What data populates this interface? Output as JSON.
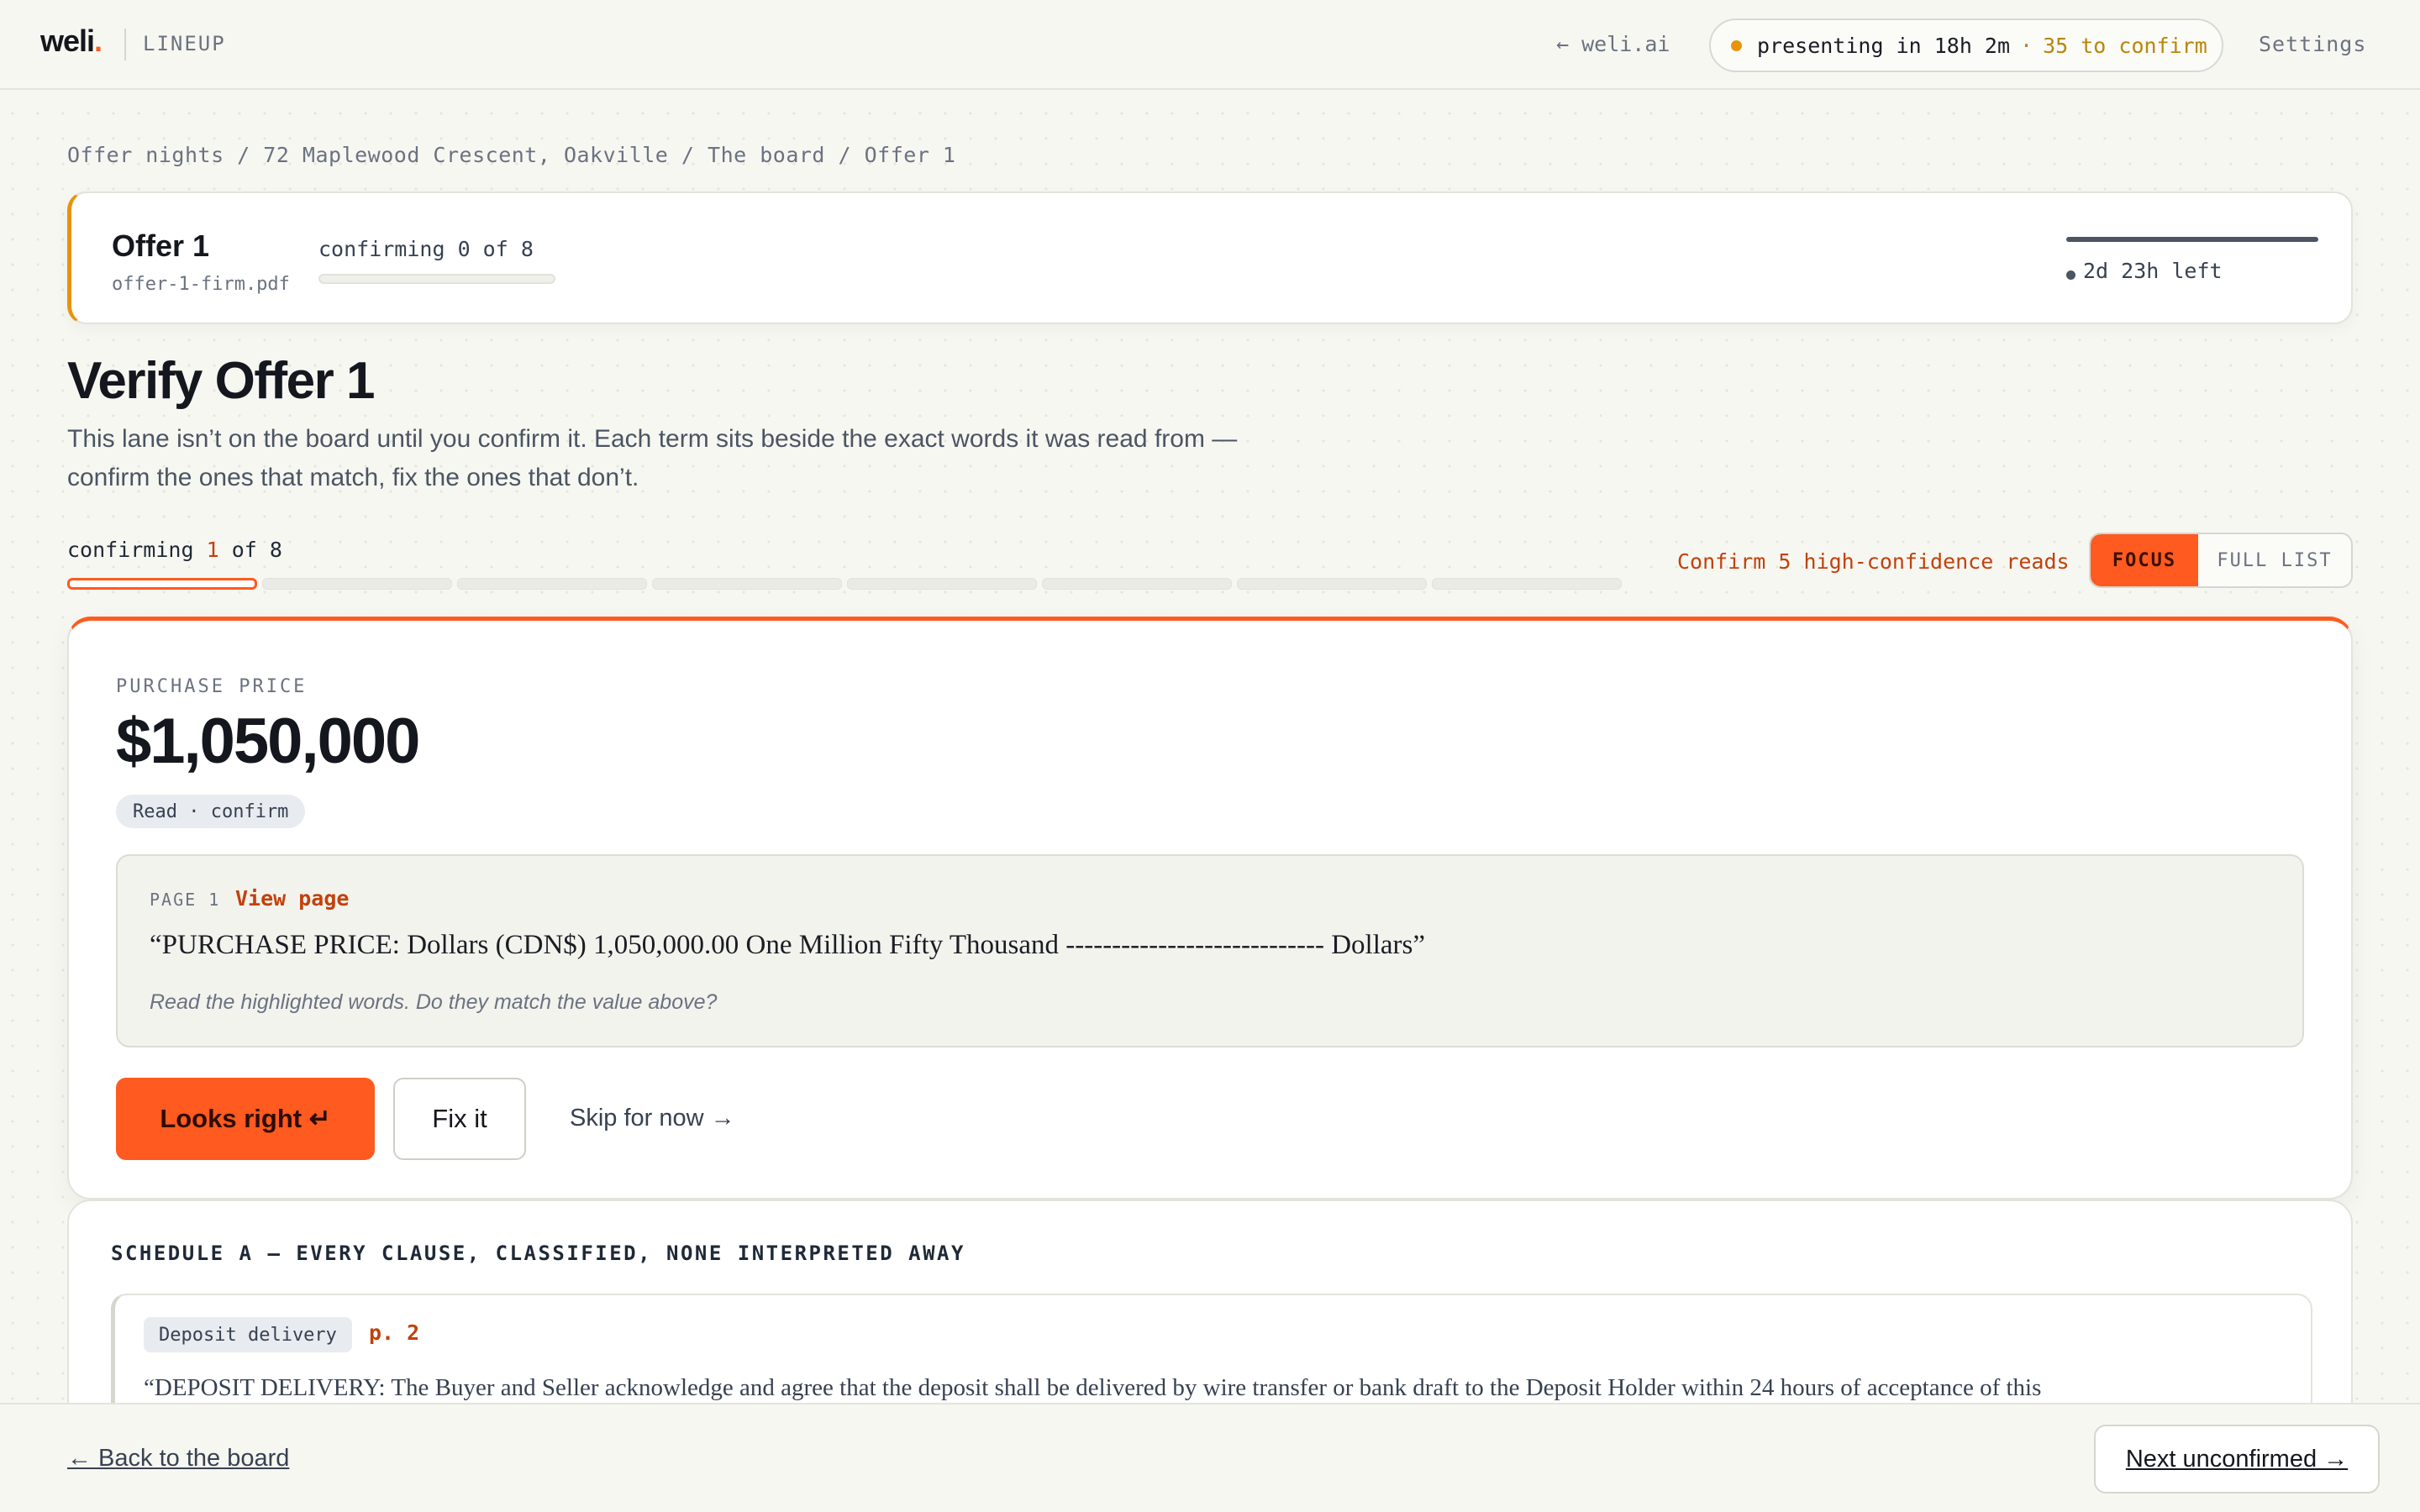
{
  "topbar": {
    "logo_text": "weli",
    "logo_dot": ".",
    "app_name": "LINEUP",
    "back_link": "← weli.ai",
    "presenting": {
      "main": "presenting in 18h 2m",
      "separator": "·",
      "confirm": "35 to confirm",
      "dot_color": "#e8930c"
    },
    "settings": "Settings"
  },
  "breadcrumb": "Offer nights / 72 Maplewood Crescent, Oakville / The board / Offer 1",
  "offer_card": {
    "title": "Offer 1",
    "file": "offer-1-firm.pdf",
    "progress_label": "confirming 0 of 8",
    "progress_fraction": 0,
    "deadline": "2d 23h left"
  },
  "page": {
    "title": "Verify Offer 1",
    "description": "This lane isn’t on the board until you confirm it. Each term sits beside the exact words it was read from — confirm the ones that match, fix the ones that don’t."
  },
  "steps": {
    "label_prefix": "confirming ",
    "current": "1",
    "label_suffix": " of 8",
    "total": 8,
    "current_index": 1,
    "bulk_confirm": "Confirm 5 high-confidence reads"
  },
  "mode_toggle": {
    "focus": "FOCUS",
    "full_list": "FULL LIST",
    "selected": "FOCUS"
  },
  "term": {
    "label": "PURCHASE PRICE",
    "value": "$1,050,000",
    "badge": "Read · confirm",
    "source": {
      "page": "PAGE 1",
      "view_page": "View page",
      "quote": "“PURCHASE PRICE: Dollars (CDN$) 1,050,000.00 One Million Fifty Thousand ---------------------------- Dollars”",
      "hint": "Read the highlighted words. Do they match the value above?"
    },
    "actions": {
      "confirm": "Looks right ↵",
      "fix": "Fix it",
      "skip": "Skip for now →"
    }
  },
  "schedule": {
    "title": "SCHEDULE A — EVERY CLAUSE, CLASSIFIED, NONE INTERPRETED AWAY",
    "clauses": [
      {
        "tag": "Deposit delivery",
        "page": "p. 2",
        "text": "“DEPOSIT DELIVERY: The Buyer and Seller acknowledge and agree that the deposit shall be delivered by wire transfer or bank draft to the Deposit Holder within 24 hours of acceptance of this"
      }
    ]
  },
  "bottombar": {
    "back": "← Back to the board",
    "next": "Next unconfirmed →"
  },
  "colors": {
    "accent": "#ff5a1f",
    "warning": "#e8930c",
    "link_red": "#c2410c"
  }
}
